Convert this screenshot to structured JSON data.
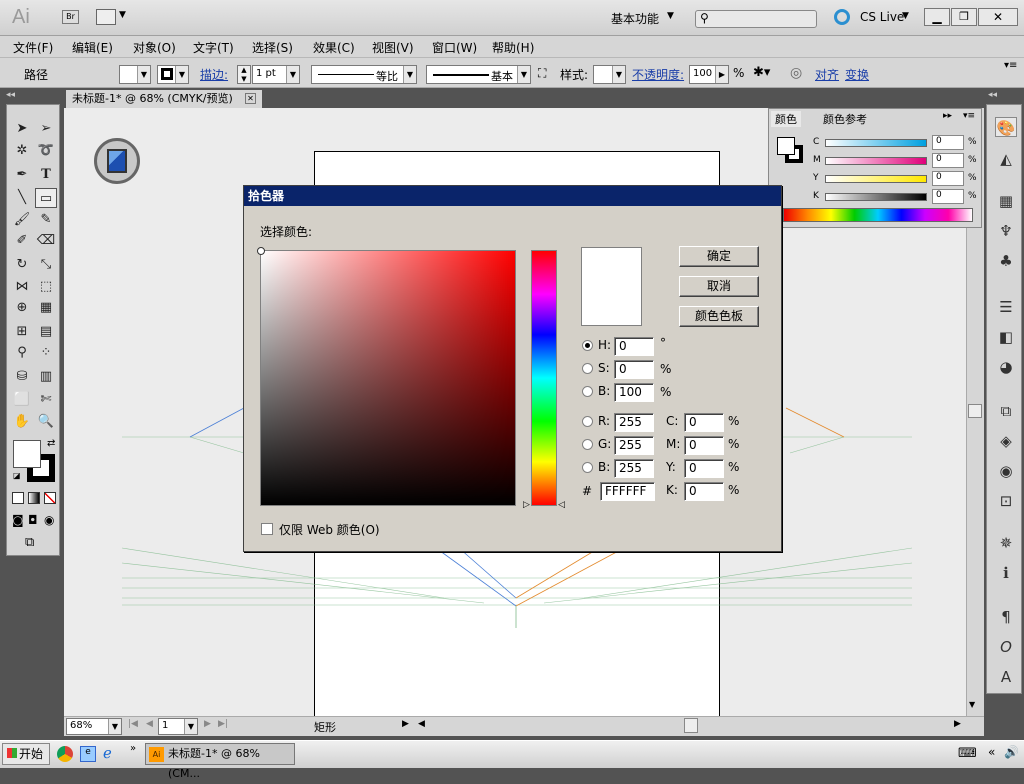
{
  "app": {
    "logo": "Ai",
    "bridge_label": "Br",
    "workspace": "基本功能",
    "search_placeholder": "",
    "cs_live": "CS Live"
  },
  "menu": [
    "文件(F)",
    "编辑(E)",
    "对象(O)",
    "文字(T)",
    "选择(S)",
    "效果(C)",
    "视图(V)",
    "窗口(W)",
    "帮助(H)"
  ],
  "control_bar": {
    "object_type": "路径",
    "stroke_label": "描边:",
    "stroke_weight": "1 pt",
    "profile_label": "等比",
    "brush_label": "基本",
    "style_label": "样式:",
    "opacity_label": "不透明度:",
    "opacity_value": "100",
    "opacity_unit": "%",
    "align_label": "对齐",
    "transform_label": "变换"
  },
  "document": {
    "tab_title": "未标题-1* @ 68% (CMYK/预览)",
    "zoom": "68%",
    "page": "1",
    "status_tool": "矩形"
  },
  "color_panel": {
    "tab_color": "颜色",
    "tab_guide": "颜色参考",
    "channels": [
      {
        "label": "C",
        "value": "0",
        "unit": "%"
      },
      {
        "label": "M",
        "value": "0",
        "unit": "%"
      },
      {
        "label": "Y",
        "value": "0",
        "unit": "%"
      },
      {
        "label": "K",
        "value": "0",
        "unit": "%"
      }
    ]
  },
  "dialog": {
    "title": "拾色器",
    "select_label": "选择颜色:",
    "ok": "确定",
    "cancel": "取消",
    "swatches": "颜色色板",
    "hsb": [
      {
        "label": "H:",
        "value": "0",
        "unit": "°"
      },
      {
        "label": "S:",
        "value": "0",
        "unit": "%"
      },
      {
        "label": "B:",
        "value": "100",
        "unit": "%"
      }
    ],
    "rgb": [
      {
        "label": "R:",
        "value": "255"
      },
      {
        "label": "G:",
        "value": "255"
      },
      {
        "label": "B:",
        "value": "255"
      }
    ],
    "cmyk": [
      {
        "label": "C:",
        "value": "0",
        "unit": "%"
      },
      {
        "label": "M:",
        "value": "0",
        "unit": "%"
      },
      {
        "label": "Y:",
        "value": "0",
        "unit": "%"
      },
      {
        "label": "K:",
        "value": "0",
        "unit": "%"
      }
    ],
    "hex_label": "#",
    "hex_value": "FFFFFF",
    "web_only_label": "仅限 Web 颜色(O)",
    "preview_color": "#ffffff"
  },
  "taskbar": {
    "start": "开始",
    "task": "未标题-1* @ 68% (CM..."
  }
}
